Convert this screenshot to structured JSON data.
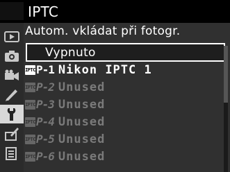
{
  "header": {
    "title": "IPTC"
  },
  "submenu": {
    "title": "Autom. vkládat při fotogr."
  },
  "tabs": [
    {
      "icon": "playback-icon"
    },
    {
      "icon": "camera-icon"
    },
    {
      "icon": "movie-camera-icon"
    },
    {
      "icon": "pencil-icon"
    },
    {
      "icon": "wrench-icon"
    },
    {
      "icon": "retouch-icon"
    },
    {
      "icon": "recent-settings-icon"
    }
  ],
  "options": {
    "off_label": "Vypnuto",
    "presets": [
      {
        "badge": "IPTC",
        "id": "P-1",
        "name": "Nikon IPTC 1"
      },
      {
        "badge": "IPTC",
        "id": "P-2",
        "name": "Unused"
      },
      {
        "badge": "IPTC",
        "id": "P-3",
        "name": "Unused"
      },
      {
        "badge": "IPTC",
        "id": "P-4",
        "name": "Unused"
      },
      {
        "badge": "IPTC",
        "id": "P-5",
        "name": "Unused"
      },
      {
        "badge": "IPTC",
        "id": "P-6",
        "name": "Unused"
      }
    ]
  },
  "colors": {
    "background": "#000000",
    "panel": "#303030",
    "tab_column": "#2b2b2b",
    "active_tab": "#d8d8d8",
    "text": "#ffffff",
    "dim_text": "#7a7a7a"
  }
}
